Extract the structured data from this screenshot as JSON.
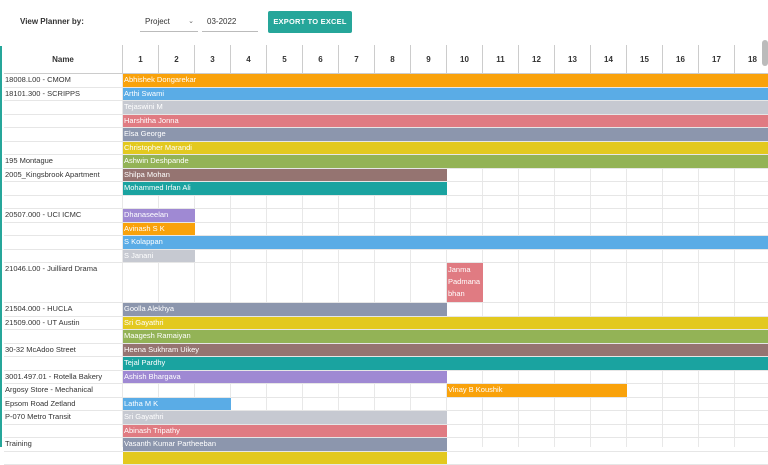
{
  "toolbar": {
    "label": "View Planner by:",
    "view_value": "Project",
    "month_value": "03-2022",
    "export_label": "EXPORT TO EXCEL"
  },
  "grid": {
    "name_header": "Name",
    "days": [
      "1",
      "2",
      "3",
      "4",
      "5",
      "6",
      "7",
      "8",
      "9",
      "10",
      "11",
      "12",
      "13",
      "14",
      "15",
      "16",
      "17",
      "18"
    ]
  },
  "rows": [
    {
      "project": "18008.L00 - CMOM",
      "assignee": "Abhishek Dongarekar",
      "start": 1,
      "end": 18,
      "color": "#f9a20b"
    },
    {
      "project": "18101.300 - SCRIPPS",
      "assignee": "Arthi Swami",
      "start": 1,
      "end": 18,
      "color": "#5aace6"
    },
    {
      "project": "",
      "assignee": "Tejaswini M",
      "start": 1,
      "end": 18,
      "color": "#c6c9d1"
    },
    {
      "project": "",
      "assignee": "Harshitha Jonna",
      "start": 1,
      "end": 18,
      "color": "#e07b82"
    },
    {
      "project": "",
      "assignee": "Elsa George",
      "start": 1,
      "end": 18,
      "color": "#8c96ad"
    },
    {
      "project": "",
      "assignee": "Christopher Marandi",
      "start": 1,
      "end": 18,
      "color": "#e3c91f"
    },
    {
      "project": "195 Montague",
      "assignee": "Ashwin Deshpande",
      "start": 1,
      "end": 18,
      "color": "#93b356"
    },
    {
      "project": "2005_Kingsbrook Apartment",
      "assignee": "Shilpa Mohan",
      "start": 1,
      "end": 9,
      "color": "#957471"
    },
    {
      "project": "",
      "assignee": "Mohammed Irfan Ali",
      "start": 1,
      "end": 9,
      "color": "#1aa3a0"
    },
    {
      "project": "",
      "assignee": "",
      "start": 0,
      "end": 0,
      "color": ""
    },
    {
      "project": "20507.000 - UCI ICMC",
      "assignee": "Dhanaseelan",
      "start": 1,
      "end": 2,
      "color": "#9f89d3"
    },
    {
      "project": "",
      "assignee": "Avinash S K",
      "start": 1,
      "end": 2,
      "color": "#f9a20b"
    },
    {
      "project": "",
      "assignee": "S Kolappan",
      "start": 1,
      "end": 18,
      "color": "#5aace6"
    },
    {
      "project": "",
      "assignee": "S Janani",
      "start": 1,
      "end": 2,
      "color": "#c6c9d1"
    },
    {
      "project": "21046.L00 - Juilliard Drama",
      "assignee": "Janma Padmanabhan",
      "assignee_lines": [
        "Janma",
        "Padmana",
        "bhan"
      ],
      "start": 10,
      "end": 10,
      "color": "#e07b82",
      "tall": true
    },
    {
      "project": "21504.000 - HUCLA",
      "assignee": "Goolla Alekhya",
      "start": 1,
      "end": 9,
      "color": "#8c96ad"
    },
    {
      "project": "21509.000 - UT Austin",
      "assignee": "Sri Gayathri",
      "start": 1,
      "end": 18,
      "color": "#e3c91f"
    },
    {
      "project": "",
      "assignee": "Maagesh Ramaiyan",
      "start": 1,
      "end": 18,
      "color": "#93b356"
    },
    {
      "project": "30-32 McAdoo Street",
      "assignee": "Heena Sukhram Uikey",
      "start": 1,
      "end": 18,
      "color": "#957471"
    },
    {
      "project": "",
      "assignee": "Tejal Pardhy",
      "start": 1,
      "end": 18,
      "color": "#1aa3a0"
    },
    {
      "project": "3001.497.01 - Rotella Bakery",
      "assignee": "Ashish Bhargava",
      "start": 1,
      "end": 9,
      "color": "#9f89d3"
    },
    {
      "project": "Argosy Store - Mechanical",
      "assignee": "Vinay B Koushik",
      "start": 10,
      "end": 14,
      "color": "#f9a20b"
    },
    {
      "project": "Epsom Road Zetland",
      "assignee": "Latha M K",
      "start": 1,
      "end": 3,
      "color": "#5aace6"
    },
    {
      "project": "P-070 Metro Transit",
      "assignee": "Sri Gayathri",
      "start": 1,
      "end": 9,
      "color": "#c6c9d1"
    },
    {
      "project": "",
      "assignee": "Abinash Tripathy",
      "start": 1,
      "end": 9,
      "color": "#e07b82"
    },
    {
      "project": "Training",
      "assignee": "Vasanth Kumar Partheeban",
      "start": 1,
      "end": 9,
      "color": "#8c96ad"
    },
    {
      "project": "",
      "assignee": "",
      "start": 1,
      "end": 9,
      "color": "#e3c91f"
    }
  ],
  "colors": {
    "accent": "#26a69a"
  }
}
